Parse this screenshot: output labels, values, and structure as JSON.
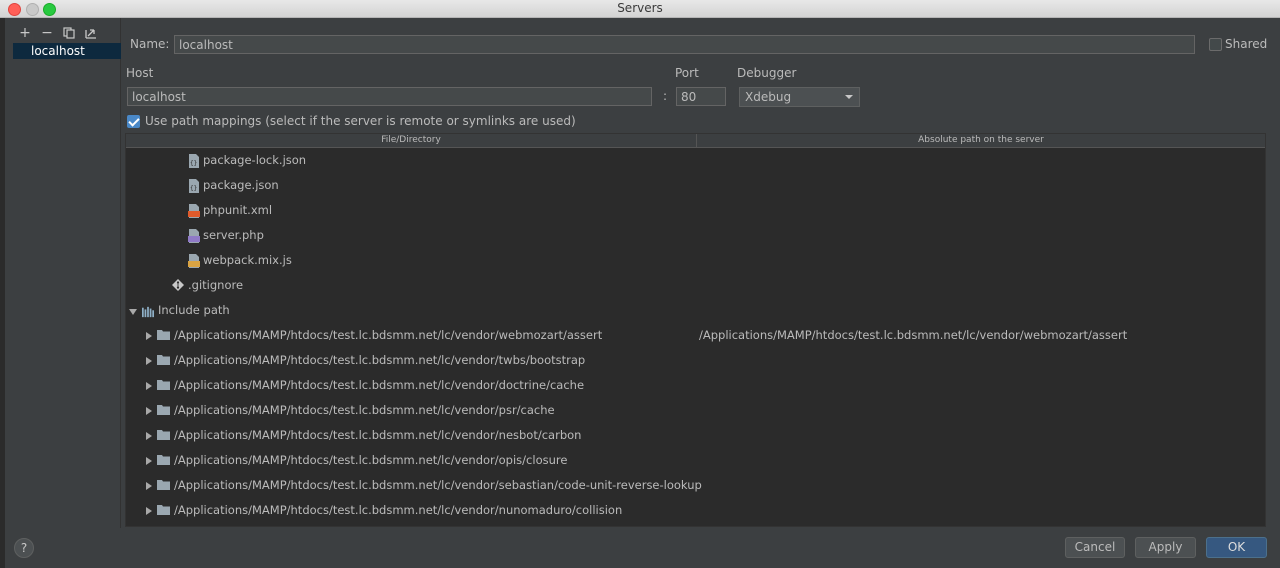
{
  "window": {
    "title": "Servers"
  },
  "left_panel": {
    "toolbar": {
      "add_label": "+",
      "remove_label": "−"
    },
    "servers": [
      "localhost"
    ]
  },
  "form": {
    "name_label": "Name:",
    "name_value": "localhost",
    "shared_label": "Shared",
    "shared_checked": false,
    "host_label": "Host",
    "host_value": "localhost",
    "port_separator": ":",
    "port_label": "Port",
    "port_value": "80",
    "debugger_label": "Debugger",
    "debugger_value": "Xdebug",
    "path_mappings_label": "Use path mappings (select if the server is remote or symlinks are used)",
    "path_mappings_checked": true
  },
  "table": {
    "headers": [
      "File/Directory",
      "Absolute path on the server"
    ],
    "file_rows": [
      {
        "name": "package-lock.json",
        "icon": "json-file-icon"
      },
      {
        "name": "package.json",
        "icon": "json-file-icon"
      },
      {
        "name": "phpunit.xml",
        "icon": "xml-file-icon"
      },
      {
        "name": "server.php",
        "icon": "php-file-icon"
      },
      {
        "name": "webpack.mix.js",
        "icon": "js-file-icon"
      }
    ],
    "gitignore_row": {
      "name": ".gitignore",
      "icon": "gitignore-file-icon"
    },
    "include_path_row": {
      "name": "Include path",
      "icon": "library-icon"
    },
    "include_rows": [
      {
        "path": "/Applications/MAMP/htdocs/test.lc.bdsmm.net/lc/vendor/webmozart/assert",
        "abs": "/Applications/MAMP/htdocs/test.lc.bdsmm.net/lc/vendor/webmozart/assert"
      },
      {
        "path": "/Applications/MAMP/htdocs/test.lc.bdsmm.net/lc/vendor/twbs/bootstrap",
        "abs": ""
      },
      {
        "path": "/Applications/MAMP/htdocs/test.lc.bdsmm.net/lc/vendor/doctrine/cache",
        "abs": ""
      },
      {
        "path": "/Applications/MAMP/htdocs/test.lc.bdsmm.net/lc/vendor/psr/cache",
        "abs": ""
      },
      {
        "path": "/Applications/MAMP/htdocs/test.lc.bdsmm.net/lc/vendor/nesbot/carbon",
        "abs": ""
      },
      {
        "path": "/Applications/MAMP/htdocs/test.lc.bdsmm.net/lc/vendor/opis/closure",
        "abs": ""
      },
      {
        "path": "/Applications/MAMP/htdocs/test.lc.bdsmm.net/lc/vendor/sebastian/code-unit-reverse-lookup",
        "abs": ""
      },
      {
        "path": "/Applications/MAMP/htdocs/test.lc.bdsmm.net/lc/vendor/nunomaduro/collision",
        "abs": ""
      }
    ]
  },
  "buttons": {
    "help": "?",
    "cancel": "Cancel",
    "apply": "Apply",
    "ok": "OK"
  },
  "colors": {
    "background": "#3c3f41",
    "table_background": "#2b2b2b",
    "selection": "#0d293e",
    "primary_button": "#365880"
  }
}
